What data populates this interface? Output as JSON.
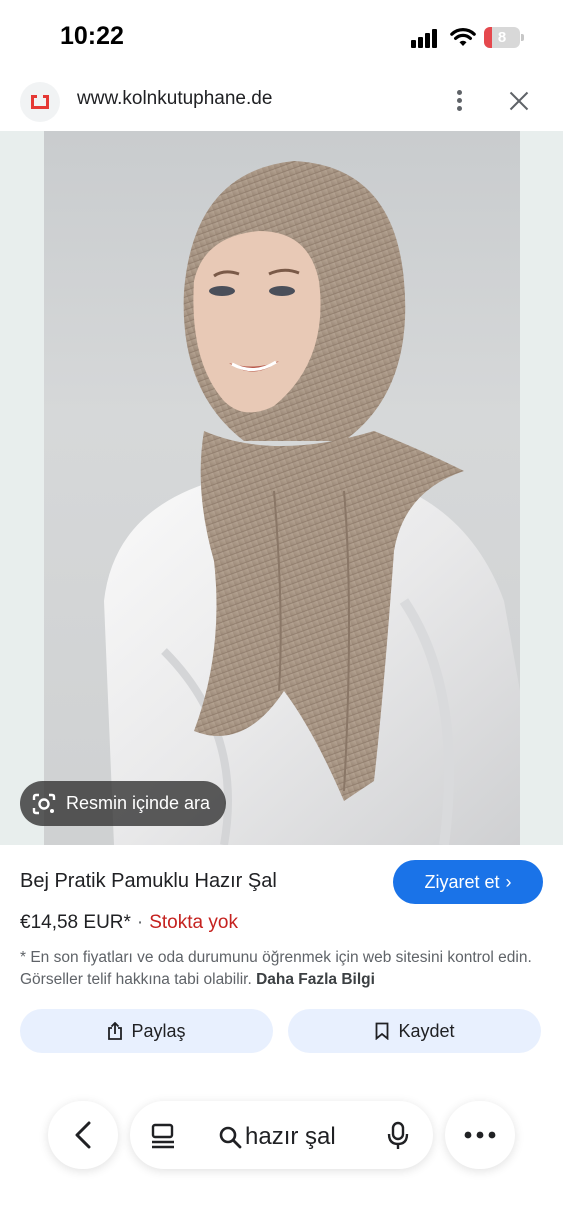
{
  "status_bar": {
    "time": "10:22",
    "battery_level": "8"
  },
  "browser": {
    "url": "www.kolnkutuphane.de"
  },
  "image_viewer": {
    "lens_label": "Resmin içinde ara"
  },
  "product": {
    "title": "Bej Pratik Pamuklu Hazır Şal",
    "price": "€14,58 EUR*",
    "separator": "·",
    "stock_status": "Stokta yok",
    "visit_label": "Ziyaret et",
    "disclaimer": "* En son fiyatları ve oda durumunu öğrenmek için web sitesini kontrol edin. Görseller telif hakkına tabi olabilir.",
    "more_info": "Daha Fazla Bilgi"
  },
  "actions": {
    "share_label": "Paylaş",
    "save_label": "Kaydet"
  },
  "bottom_bar": {
    "query": "hazır şal"
  },
  "colors": {
    "accent": "#1a73e8",
    "stock_out": "#c5221f",
    "chip_bg": "#e8f0fe"
  }
}
